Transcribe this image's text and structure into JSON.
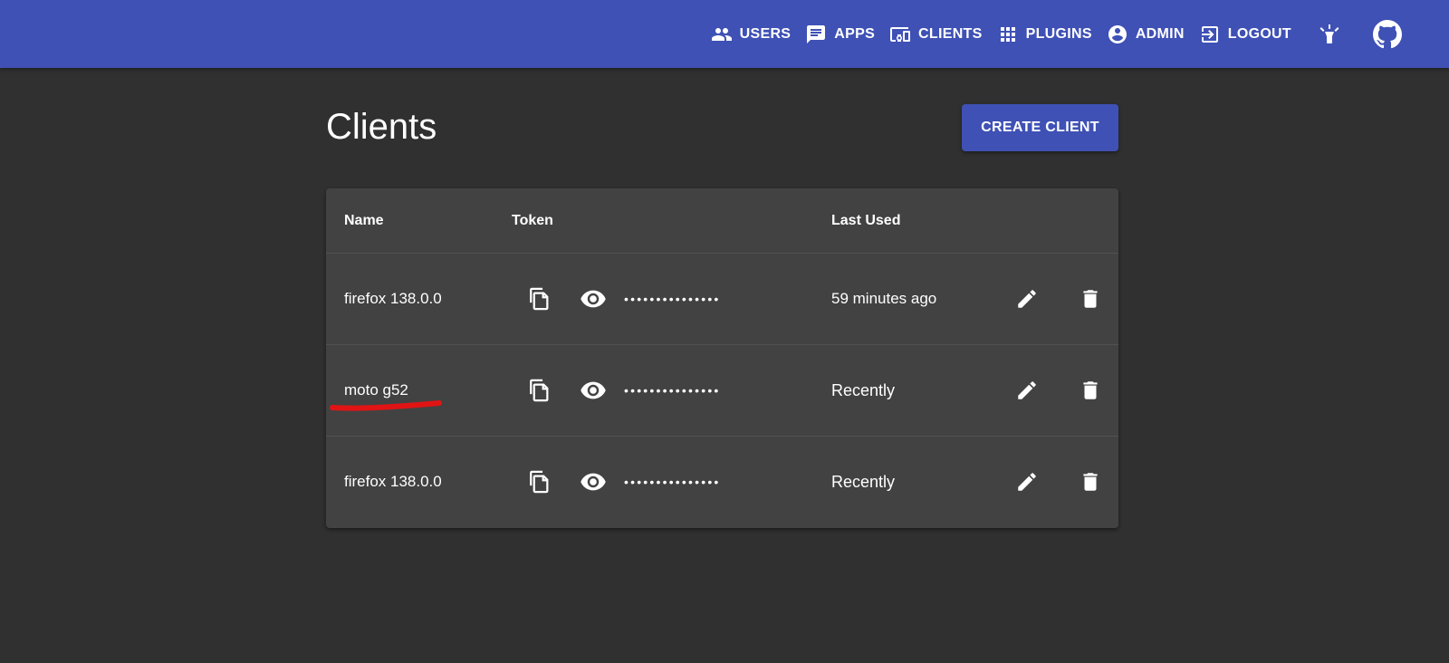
{
  "nav": {
    "items": [
      {
        "label": "USERS",
        "icon": "people-icon"
      },
      {
        "label": "APPS",
        "icon": "chat-icon"
      },
      {
        "label": "CLIENTS",
        "icon": "devices-icon"
      },
      {
        "label": "PLUGINS",
        "icon": "apps-grid-icon"
      },
      {
        "label": "ADMIN",
        "icon": "account-circle-icon"
      },
      {
        "label": "LOGOUT",
        "icon": "exit-icon"
      }
    ],
    "theme_toggle_icon": "lightbulb-icon",
    "github_icon": "github-icon"
  },
  "page": {
    "title": "Clients",
    "create_button": "CREATE CLIENT"
  },
  "table": {
    "headers": {
      "name": "Name",
      "token": "Token",
      "last_used": "Last Used"
    },
    "rows": [
      {
        "name": "firefox 138.0.0",
        "token": "•••••••••••••••",
        "last_used": "59 minutes ago"
      },
      {
        "name": "moto g52",
        "token": "•••••••••••••••",
        "last_used": "Recently",
        "annotation": "red-underline"
      },
      {
        "name": "firefox 138.0.0",
        "token": "•••••••••••••••",
        "last_used": "Recently"
      }
    ]
  },
  "colors": {
    "appbar": "#3f51b5",
    "background": "#303030",
    "card": "#424242",
    "annotation": "#e01414"
  }
}
